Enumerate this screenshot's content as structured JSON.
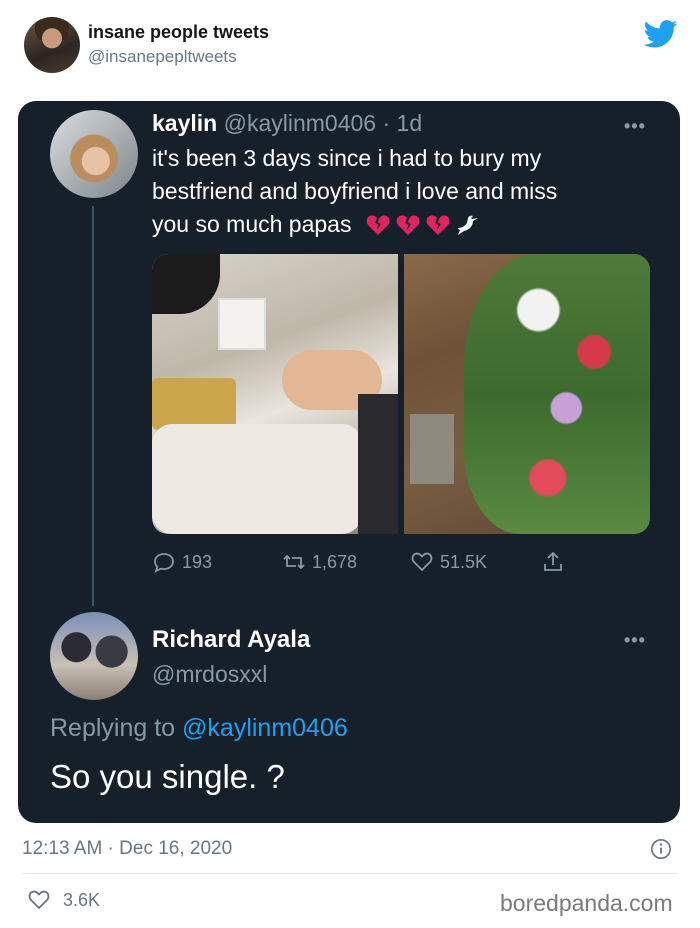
{
  "outer": {
    "name": "insane people tweets",
    "handle": "@insanepepltweets"
  },
  "original_tweet": {
    "name": "kaylin",
    "handle": "@kaylinm0406",
    "time": "· 1d",
    "more": "•••",
    "text_line1": "it's been 3 days since i had to bury my",
    "text_line2": "bestfriend and boyfriend i love and miss",
    "text_line3": "you so much papas",
    "emojis": [
      "broken-heart-icon",
      "broken-heart-icon",
      "broken-heart-icon",
      "dove-icon"
    ],
    "replies": "193",
    "retweets": "1,678",
    "likes": "51.5K"
  },
  "reply_tweet": {
    "name": "Richard Ayala",
    "handle": "@mrdosxxl",
    "more": "•••",
    "replying_prefix": "Replying to",
    "replying_handle": "@kaylinm0406",
    "text": "So you single. ?"
  },
  "footer": {
    "timestamp": "12:13 AM · Dec 16, 2020",
    "likes": "3.6K",
    "watermark": "boredpanda.com"
  },
  "colors": {
    "card_bg": "#15202b",
    "twitter_blue": "#1da1f2",
    "muted": "#8899a6",
    "heart_red": "#e0245e"
  }
}
